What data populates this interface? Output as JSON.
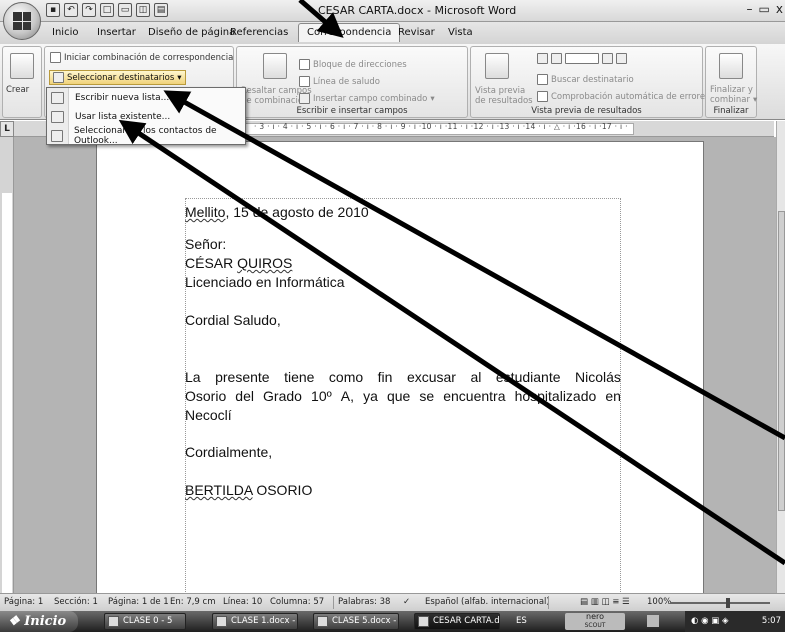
{
  "window": {
    "title": "CESAR CARTA.docx - Microsoft Word",
    "controls": [
      "–",
      "▭",
      "x"
    ]
  },
  "tabs": [
    "Inicio",
    "Insertar",
    "Diseño de página",
    "Referencias",
    "Correspondencia",
    "Revisar",
    "Vista"
  ],
  "active_tab": "Correspondencia",
  "ribbon": {
    "crear": "Crear",
    "iniciar_combinacion": "Iniciar combinación de correspondencia",
    "seleccionar_destinatarios": "Seleccionar destinatarios",
    "resaltar_campos": "Resaltar campos",
    "de_combinacion": "de combinación",
    "bloque_direcciones": "Bloque de direcciones",
    "linea_saludo": "Línea de saludo",
    "insertar_campo": "Insertar campo combinado",
    "group_escribir": "Escribir e insertar campos",
    "vista_previa": "Vista previa",
    "de_resultados": "de resultados",
    "buscar_destinatario": "Buscar destinatario",
    "comprobacion": "Comprobación automática de errores",
    "group_vista_previa": "Vista previa de resultados",
    "finalizar_y": "Finalizar y",
    "combinar": "combinar",
    "group_finalizar": "Finalizar"
  },
  "dropdown": {
    "items": [
      "Escribir nueva lista...",
      "Usar lista existente...",
      "Seleccionar de los contactos de Outlook..."
    ]
  },
  "ruler": {
    "h_marks": "· 3 · ı · 4 · ı · 5 · ı · 6 · ı · 7 · ı · 8 · ı · 9 · ı ·10 · ı ·11 · ı ·12 · ı ·13 · ı ·14 · ı · △ · ı ·16 · ı ·17 · ı ·"
  },
  "document": {
    "line1_place": "Mellito",
    "line1_rest": ", 15 de agosto de 2010",
    "senor": "Señor:",
    "name_first": "CÉSAR ",
    "name_last": "QUIROS",
    "title": "Licenciado en Informática",
    "greeting": "Cordial Saludo,",
    "p1_words": [
      "La",
      "presente",
      "tiene",
      "como",
      "fin",
      "excusar",
      "al",
      "estudiante",
      "Nicolás"
    ],
    "p2_words": [
      "Osorio",
      "del",
      "Grado",
      "10º",
      "A,",
      "ya",
      "que",
      "se",
      "encuentra",
      "hospitalizado",
      "en"
    ],
    "p3": "Necoclí",
    "closing": "Cordialmente,",
    "sig_first": "BERTILDA",
    "sig_last": " OSORIO"
  },
  "statusbar": {
    "pagina": "Página: 1",
    "seccion": "Sección: 1",
    "pagina_de": "Página: 1 de 1",
    "en": "En: 7,9 cm",
    "linea": "Línea: 10",
    "columna": "Columna: 57",
    "palabras": "Palabras: 38",
    "idioma": "Español (alfab. internacional)",
    "zoom": "100%"
  },
  "taskbar": {
    "start": "Inicio",
    "buttons": [
      "CLASE 0 - 5",
      "CLASE 1.docx - ...",
      "CLASE 5.docx - ...",
      "CESAR CARTA.d..."
    ],
    "lang": "ES",
    "nero": "nero",
    "nero_sub": "SCOUT",
    "clock": "5:07"
  }
}
